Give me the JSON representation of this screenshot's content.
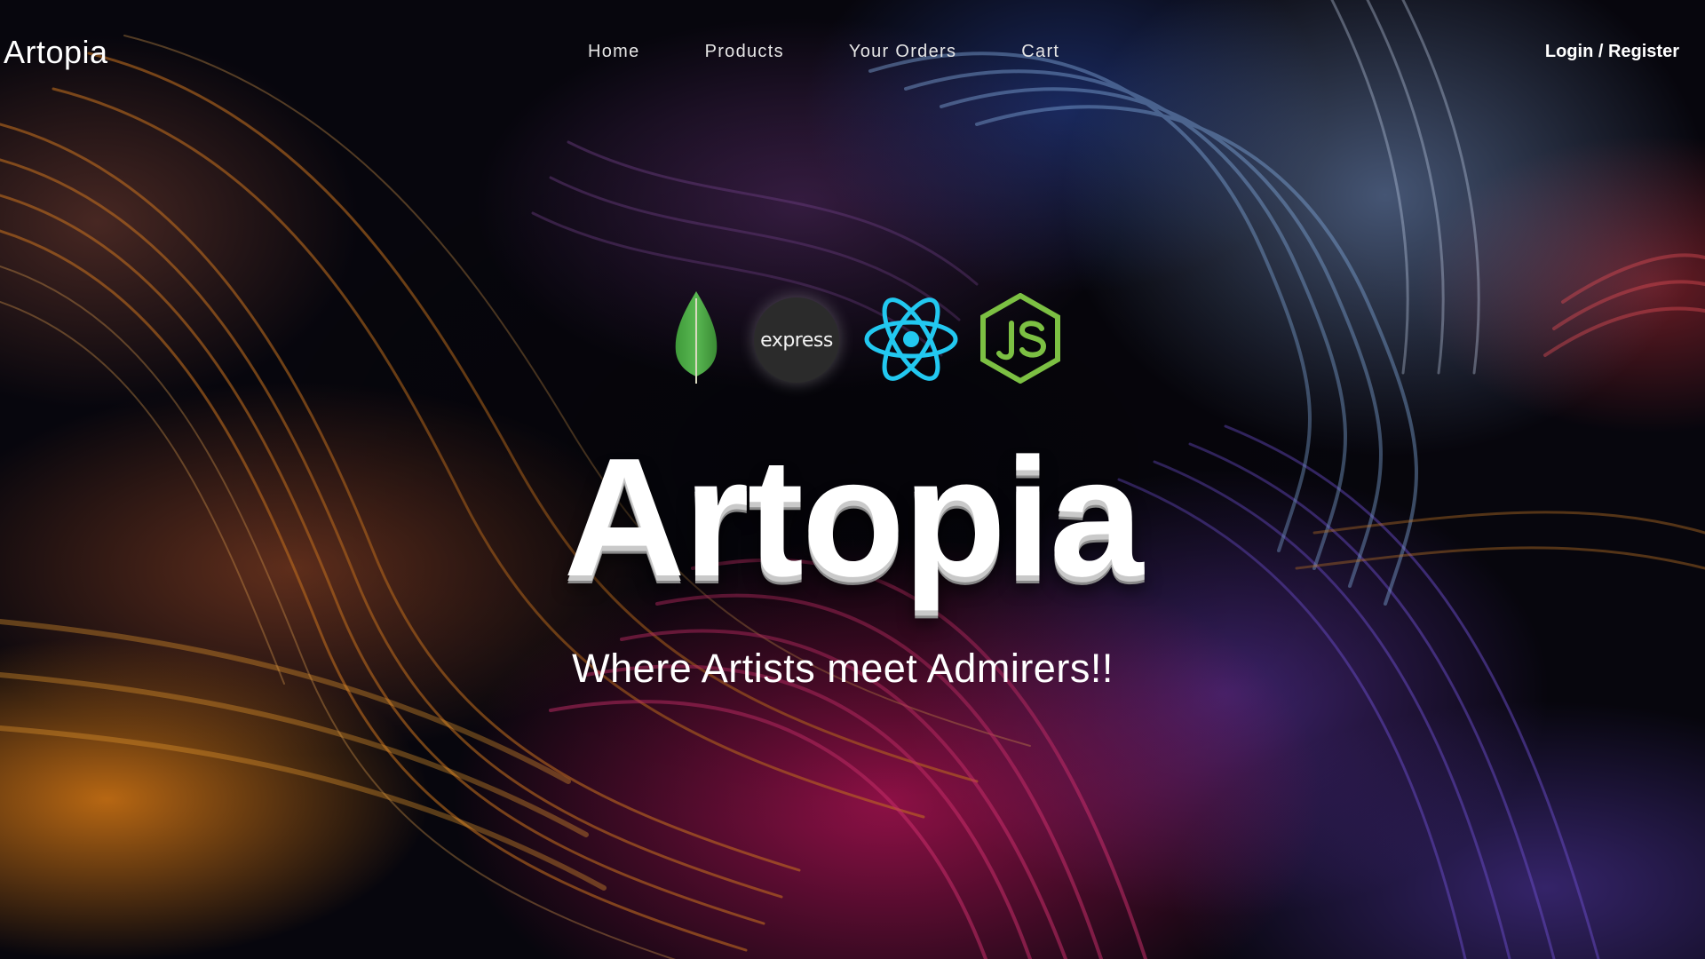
{
  "navbar": {
    "brand": "Artopia",
    "links": [
      {
        "label": "Home"
      },
      {
        "label": "Products"
      },
      {
        "label": "Your Orders"
      },
      {
        "label": "Cart"
      }
    ],
    "auth_label": "Login / Register"
  },
  "tech_logos": [
    {
      "name": "mongodb-icon",
      "color": "#4faa41"
    },
    {
      "name": "express-icon",
      "text": "express",
      "color": "#2b2b2b"
    },
    {
      "name": "react-icon",
      "color": "#61dafb"
    },
    {
      "name": "nodejs-icon",
      "color": "#8cc84b"
    }
  ],
  "hero": {
    "title": "Artopia",
    "tagline": "Where Artists meet Admirers!!"
  }
}
